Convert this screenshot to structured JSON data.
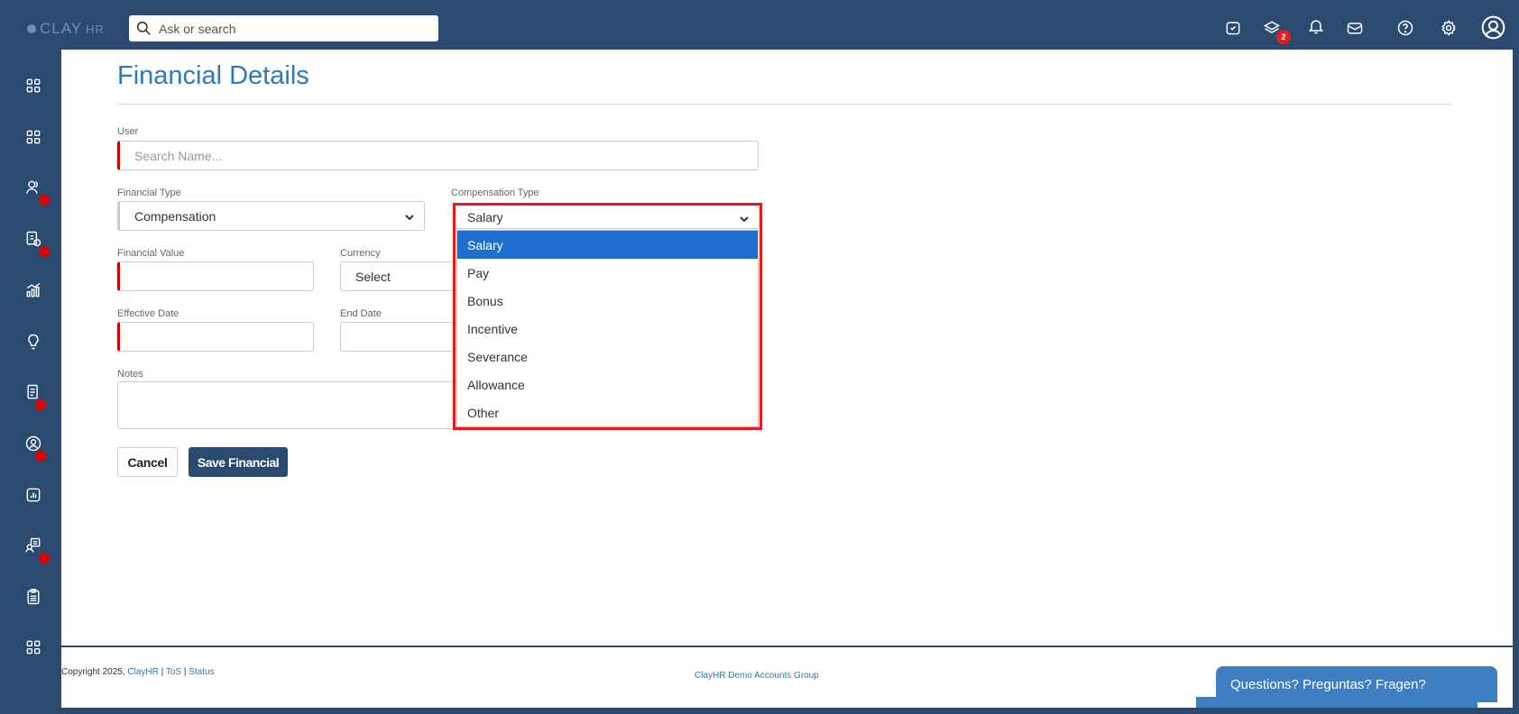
{
  "app": {
    "logo_text": "CLAY",
    "logo_suffix": "HR"
  },
  "search": {
    "placeholder": "Ask or search"
  },
  "topbar": {
    "notification_badge": "2",
    "icons": [
      "alarm-clock-icon",
      "layers-icon",
      "bell-icon",
      "mail-icon",
      "help-icon",
      "settings-icon",
      "user-avatar-icon"
    ]
  },
  "sidebar": {
    "items": [
      "apps-grid-icon",
      "apps-grid-icon",
      "people-icon",
      "payroll-icon",
      "growth-chart-icon",
      "lightbulb-icon",
      "documents-icon",
      "profile-circle-icon",
      "analytics-icon",
      "training-icon",
      "clipboard-icon",
      "apps-grid-icon"
    ]
  },
  "page": {
    "title": "Financial Details"
  },
  "form": {
    "user_label": "User",
    "user_placeholder": "Search Name...",
    "financial_type_label": "Financial Type",
    "financial_type_value": "Compensation",
    "compensation_type_label": "Compensation Type",
    "compensation_type_value": "Salary",
    "financial_value_label": "Financial Value",
    "currency_label": "Currency",
    "currency_value": "Select",
    "effective_date_label": "Effective Date",
    "end_date_label": "End Date",
    "notes_label": "Notes",
    "cancel_label": "Cancel",
    "save_label": "Save Financial"
  },
  "dropdown": {
    "options": [
      "Salary",
      "Pay",
      "Bonus",
      "Incentive",
      "Severance",
      "Allowance",
      "Other"
    ],
    "selected": "Salary"
  },
  "footer": {
    "copyright": "Copyright 2025, ",
    "company_link": "ClayHR",
    "sep": " | ",
    "tos": "ToS",
    "status": "Status",
    "group": "ClayHR Demo Accounts Group",
    "chat": "Questions? Preguntas? Fragen?"
  },
  "colors": {
    "nav": "#2b4a6f",
    "accent": "#2f78b9",
    "selected": "#1f6fd1",
    "required": "#cc0000",
    "highlight": "#e21a1a"
  }
}
